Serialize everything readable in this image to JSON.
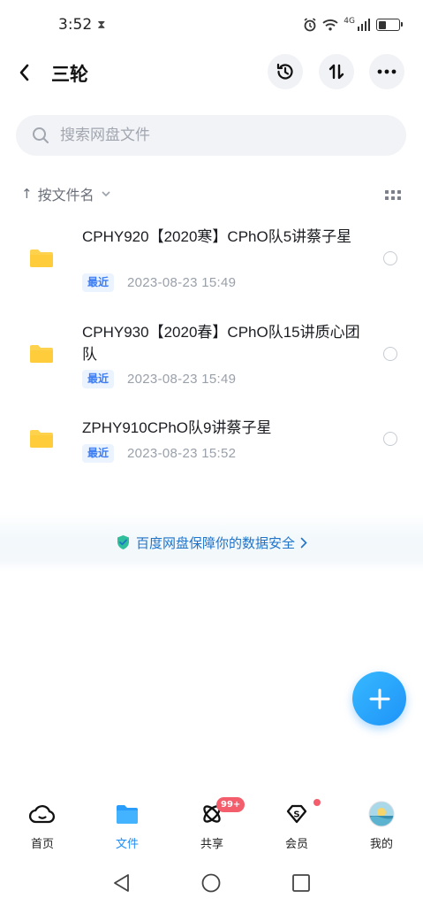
{
  "status_bar": {
    "time": "3:52",
    "network": "4G"
  },
  "header": {
    "title": "三轮"
  },
  "search": {
    "placeholder": "搜索网盘文件"
  },
  "sort": {
    "label": "按文件名"
  },
  "files": [
    {
      "name": "CPHY920【2020寒】CPhO队5讲蔡子星",
      "badge": "最近",
      "date": "2023-08-23  15:49"
    },
    {
      "name": "CPHY930【2020春】CPhO队15讲质心团队",
      "badge": "最近",
      "date": "2023-08-23  15:49"
    },
    {
      "name": "ZPHY910CPhO队9讲蔡子星",
      "badge": "最近",
      "date": "2023-08-23  15:52"
    }
  ],
  "security_banner": {
    "text": "百度网盘保障你的数据安全"
  },
  "bottom_nav": {
    "items": [
      {
        "label": "首页",
        "icon": "cloud-home-icon"
      },
      {
        "label": "文件",
        "icon": "folder-icon"
      },
      {
        "label": "共享",
        "icon": "share-atom-icon",
        "badge": "99+"
      },
      {
        "label": "会员",
        "icon": "vip-diamond-icon"
      },
      {
        "label": "我的",
        "icon": "avatar-icon"
      }
    ]
  },
  "colors": {
    "accent": "#1e8cf4",
    "badge_bg": "#eaf3fe",
    "folder": "#ffd24d",
    "alert": "#f35d6c"
  }
}
